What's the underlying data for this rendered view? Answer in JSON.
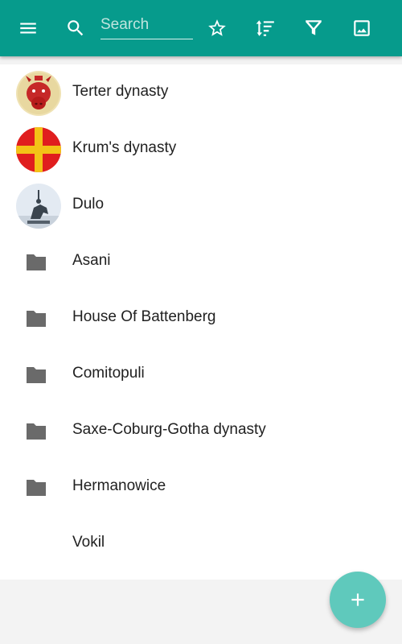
{
  "toolbar": {
    "background": "#069b8c",
    "menu_icon": "menu-icon",
    "search_icon": "search-icon",
    "search_placeholder": "Search",
    "search_value": "",
    "actions": [
      "star-icon",
      "sort-icon",
      "filter-icon",
      "image-icon"
    ]
  },
  "list": {
    "items": [
      {
        "label": "Terter dynasty",
        "icon": "terter-crest-avatar"
      },
      {
        "label": "Krum's dynasty",
        "icon": "krum-flag-avatar"
      },
      {
        "label": "Dulo",
        "icon": "dulo-statue-avatar"
      },
      {
        "label": "Asani",
        "icon": "folder-icon"
      },
      {
        "label": "House Of Battenberg",
        "icon": "folder-icon"
      },
      {
        "label": "Comitopuli",
        "icon": "folder-icon"
      },
      {
        "label": "Saxe-Coburg-Gotha dynasty",
        "icon": "folder-icon"
      },
      {
        "label": "Hermanowice",
        "icon": "folder-icon"
      },
      {
        "label": "Vokil",
        "icon": ""
      }
    ]
  },
  "fab": {
    "icon": "add-icon",
    "color": "#5fc9bc"
  }
}
